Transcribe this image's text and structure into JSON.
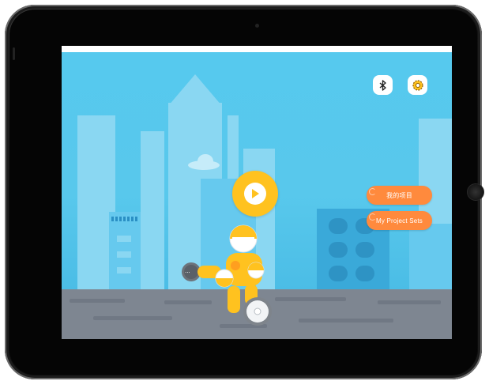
{
  "device": {
    "type": "tablet"
  },
  "toolbar": {
    "bluetooth_icon": "bluetooth-icon",
    "settings_icon": "gear-icon"
  },
  "buttons": {
    "my_projects_cn": "我的项目",
    "my_project_sets": "My Project Sets"
  },
  "play": {
    "icon": "play-icon"
  },
  "robot": {
    "handle_label": "..."
  },
  "colors": {
    "sky": "#56c9ee",
    "accent_orange": "#ff8a3d",
    "play_yellow": "#ffc21f",
    "ground": "#7e8691",
    "robot_yellow": "#ffc21f"
  }
}
